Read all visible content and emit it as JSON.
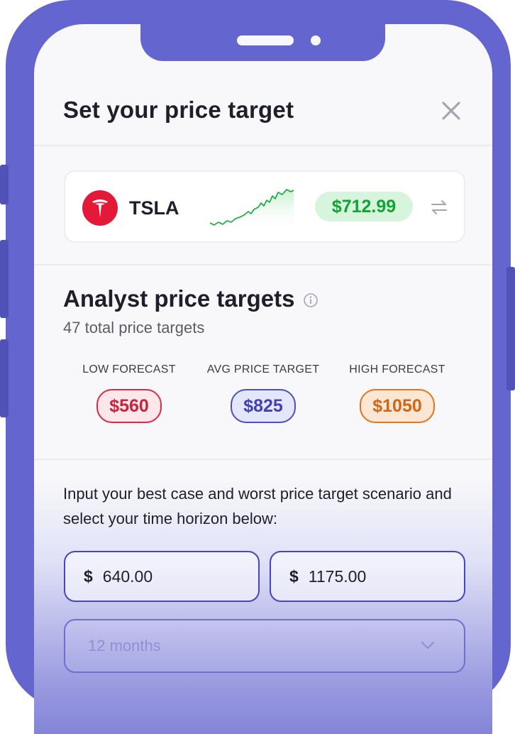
{
  "modal": {
    "title": "Set your price target"
  },
  "ticker": {
    "symbol": "TSLA",
    "price": "$712.99"
  },
  "analyst": {
    "title": "Analyst price targets",
    "subtitle": "47 total price targets",
    "forecasts": [
      {
        "label": "LOW FORECAST",
        "value": "$560"
      },
      {
        "label": "AVG PRICE TARGET",
        "value": "$825"
      },
      {
        "label": "HIGH FORECAST",
        "value": "$1050"
      }
    ]
  },
  "scenario": {
    "instructions": "Input your best case and worst price target scenario and select your time horizon below:",
    "currency_symbol": "$",
    "worst_case_value": "640.00",
    "best_case_value": "1175.00",
    "time_horizon": "12 months"
  },
  "colors": {
    "frame": "#6465cf",
    "price_up": "#12a335",
    "low": "#d92b45",
    "avg": "#4d4fc3",
    "high": "#e07622"
  },
  "icons": {
    "close": "close-icon",
    "logo": "tesla-logo-icon",
    "swap": "swap-icon",
    "info": "info-icon",
    "dropdown": "chevron-down-icon"
  }
}
